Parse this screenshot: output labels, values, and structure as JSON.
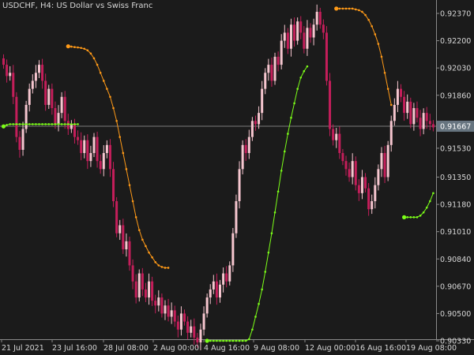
{
  "window": {
    "symbol": "USDCHF, H4:",
    "description": "US Dollar vs Swiss Franc"
  },
  "chart_data": {
    "type": "candlestick",
    "title": "USDCHF, H4:  US Dollar vs Swiss Franc",
    "colors": {
      "background": "#1b1b1b",
      "bull_candle": "#f6c6cf",
      "bear_candle": "#c41e5a",
      "upper_line": "#ff9a18",
      "lower_line": "#7cff18",
      "axis_text": "#d6d6d6",
      "current_price_bg": "#66747f"
    },
    "y_ticks": [
      "0.92370",
      "0.92200",
      "0.92030",
      "0.91860",
      "0.91530",
      "0.91350",
      "0.91180",
      "0.91010",
      "0.90840",
      "0.90670",
      "0.90500",
      "0.90330"
    ],
    "y_range": [
      0.9022,
      0.9249
    ],
    "current_price": "0.91667",
    "x_ticks": [
      "21 Jul 2021",
      "23 Jul 16:00",
      "28 Jul 08:00",
      "2 Aug 00:00",
      "4 Aug 16:00",
      "9 Aug 08:00",
      "12 Aug 00:00",
      "16 Aug 16:00",
      "19 Aug 08:00"
    ],
    "candle_count": 134,
    "candle_close": [
      0.9205,
      0.9198,
      0.92,
      0.9185,
      0.916,
      0.9152,
      0.9165,
      0.918,
      0.919,
      0.9195,
      0.92,
      0.9205,
      0.9195,
      0.918,
      0.919,
      0.9178,
      0.9168,
      0.9175,
      0.9185,
      0.917,
      0.9165,
      0.9168,
      0.916,
      0.9158,
      0.915,
      0.9158,
      0.9145,
      0.915,
      0.916,
      0.9145,
      0.914,
      0.915,
      0.9155,
      0.914,
      0.912,
      0.91,
      0.9105,
      0.909,
      0.9095,
      0.908,
      0.907,
      0.906,
      0.9075,
      0.9065,
      0.906,
      0.907,
      0.9058,
      0.9055,
      0.906,
      0.905,
      0.9055,
      0.9048,
      0.9052,
      0.9045,
      0.904,
      0.905,
      0.9045,
      0.9038,
      0.9042,
      0.9035,
      0.9032,
      0.904,
      0.905,
      0.906,
      0.9065,
      0.907,
      0.906,
      0.9068,
      0.9075,
      0.907,
      0.908,
      0.91,
      0.912,
      0.914,
      0.9155,
      0.915,
      0.916,
      0.917,
      0.9168,
      0.9175,
      0.919,
      0.92,
      0.9205,
      0.9195,
      0.921,
      0.9205,
      0.922,
      0.9225,
      0.9215,
      0.923,
      0.922,
      0.9232,
      0.9225,
      0.9215,
      0.9228,
      0.9222,
      0.923,
      0.9238,
      0.923,
      0.9225,
      0.9195,
      0.9165,
      0.9158,
      0.9162,
      0.915,
      0.9145,
      0.914,
      0.9135,
      0.9145,
      0.913,
      0.9125,
      0.9135,
      0.9128,
      0.9115,
      0.912,
      0.913,
      0.914,
      0.915,
      0.9135,
      0.9155,
      0.917,
      0.918,
      0.919,
      0.9185,
      0.9175,
      0.9182,
      0.9168,
      0.9178,
      0.9172,
      0.9165,
      0.9175,
      0.917,
      0.9168,
      0.9166
    ],
    "upper_start_index": 20,
    "upper_line": [
      0.92165,
      0.92163,
      0.9216,
      0.92158,
      0.92155,
      0.9215,
      0.9214,
      0.9212,
      0.9209,
      0.9205,
      0.92,
      0.9195,
      0.919,
      0.9185,
      0.9178,
      0.917,
      0.916,
      0.915,
      0.914,
      0.913,
      0.912,
      0.911,
      0.9102,
      0.9096,
      0.9092,
      0.9088,
      0.9085,
      0.9082,
      0.908,
      0.9079,
      0.90785,
      0.90785
    ],
    "upper_line2": [
      0.924,
      0.924,
      0.924,
      0.924,
      0.924,
      0.924,
      0.92395,
      0.9239,
      0.9238,
      0.9236,
      0.9233,
      0.9229,
      0.9224,
      0.9218,
      0.921,
      0.92,
      0.919,
      0.918
    ],
    "lower_line1": [
      0.91666,
      0.91675,
      0.9168,
      0.9168,
      0.9168,
      0.9168,
      0.9168,
      0.9168,
      0.9168,
      0.9168,
      0.9168,
      0.9168,
      0.9168,
      0.9168,
      0.9168,
      0.9168,
      0.9168,
      0.9168,
      0.9168,
      0.9168,
      0.9168,
      0.9168,
      0.9168,
      0.9168
    ],
    "lower_line2": [
      0.9033,
      0.9033,
      0.9033,
      0.9033,
      0.9033,
      0.9033,
      0.9033,
      0.9033,
      0.9033,
      0.9033,
      0.9033,
      0.9033,
      0.9033,
      0.9034,
      0.904,
      0.9048,
      0.9056,
      0.9065,
      0.9076,
      0.9088,
      0.91,
      0.9113,
      0.9126,
      0.9139,
      0.9151,
      0.9162,
      0.9172,
      0.9181,
      0.919,
      0.9197,
      0.9201,
      0.9204
    ],
    "lower_line3": [
      0.911,
      0.911,
      0.911,
      0.911,
      0.911,
      0.9111,
      0.9113,
      0.9116,
      0.912,
      0.9125
    ]
  }
}
